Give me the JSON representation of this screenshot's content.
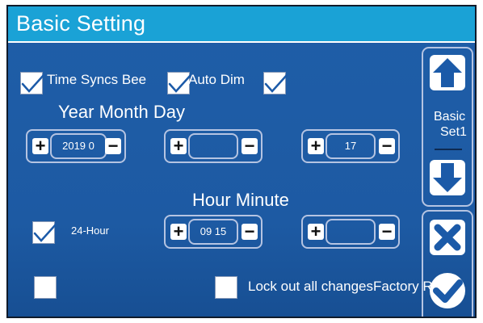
{
  "header": {
    "title": "Basic Setting"
  },
  "options": {
    "time_syncs_label": "Time Syncs Bee",
    "auto_dim_label": "Auto Dim",
    "hour24_label": "24-Hour",
    "lockout_label": "Lock out all changesFactory Res"
  },
  "date": {
    "heading": "Year Month Day",
    "year_value": "2019 0",
    "month_value": "",
    "day_value": "17"
  },
  "time": {
    "heading": "Hour Minute",
    "hour_minute_value": "09 15",
    "second_value": ""
  },
  "sidebar": {
    "page_label_line1": "Basic",
    "page_label_line2": "Set1"
  },
  "stepper": {
    "plus": "+",
    "minus": "−"
  },
  "colors": {
    "title_bar": "#1aa2d6",
    "background": "#1d5aa3",
    "border": "#b5c4e2",
    "text": "#ffffff",
    "icon": "#1b5aa8"
  },
  "icons": [
    "arrow-up-icon",
    "arrow-down-icon",
    "close-x-icon",
    "check-icon",
    "checkmark-icon"
  ]
}
